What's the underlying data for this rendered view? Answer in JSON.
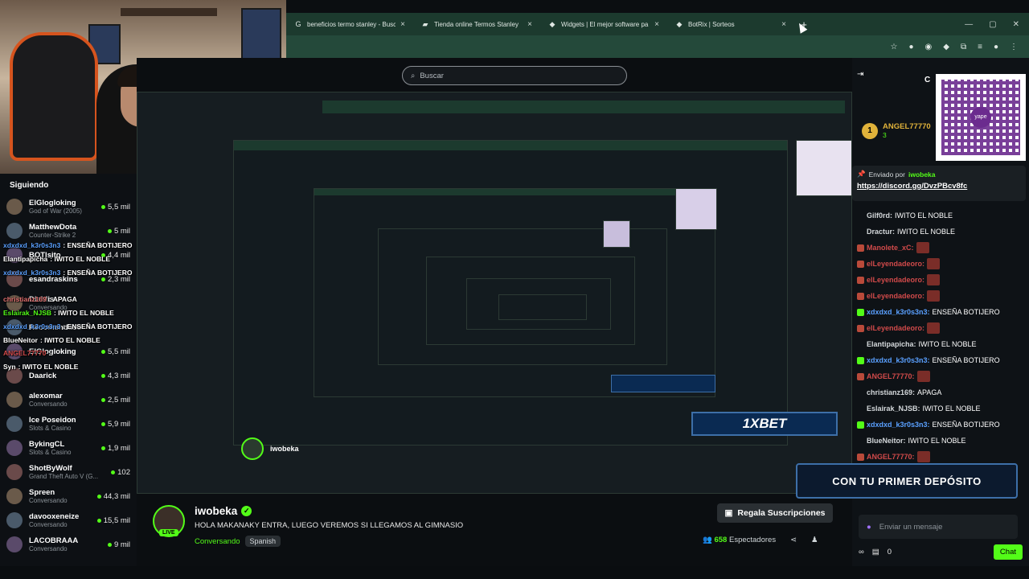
{
  "browser": {
    "tabs": [
      {
        "label": "beneficios termo stanley - Busc",
        "icon": "google-icon"
      },
      {
        "label": "Tienda online Termos Stanley",
        "icon": "store-icon"
      },
      {
        "label": "Widgets | El mejor software pa",
        "icon": "widget-icon"
      },
      {
        "label": "BotRix | Sorteos",
        "icon": "botrix-icon"
      }
    ]
  },
  "search": {
    "placeholder": "Buscar"
  },
  "sidebar": {
    "title": "Siguiendo",
    "items": [
      {
        "name": "ElGlogloking",
        "game": "God of War (2005)",
        "viewers": "5,5 mil"
      },
      {
        "name": "MatthewDota",
        "game": "Counter-Strike 2",
        "viewers": "5 mil"
      },
      {
        "name": "BOTlsito",
        "game": "",
        "viewers": "4,4 mil"
      },
      {
        "name": "esandraskins",
        "game": "",
        "viewers": "2,3 mil"
      },
      {
        "name": "Diablis",
        "game": "Conversando",
        "viewers": ""
      },
      {
        "name": "Recomendado",
        "game": "",
        "viewers": ""
      },
      {
        "name": "ElGlogloking",
        "game": "",
        "viewers": "5,5 mil"
      },
      {
        "name": "Daarick",
        "game": "",
        "viewers": "4,3 mil"
      },
      {
        "name": "alexomar",
        "game": "Conversando",
        "viewers": "2,5 mil"
      },
      {
        "name": "Ice Poseidon",
        "game": "Slots & Casino",
        "viewers": "5,9 mil"
      },
      {
        "name": "BykingCL",
        "game": "Slots & Casino",
        "viewers": "1,9 mil"
      },
      {
        "name": "ShotByWolf",
        "game": "Grand Theft Auto V (G...",
        "viewers": "102"
      },
      {
        "name": "Spreen",
        "game": "Conversando",
        "viewers": "44,3 mil"
      },
      {
        "name": "davooxeneize",
        "game": "Conversando",
        "viewers": "15,5 mil"
      },
      {
        "name": "LACOBRAAA",
        "game": "Conversando",
        "viewers": "9 mil"
      }
    ]
  },
  "overlay_chat": [
    {
      "user": "xdxdxd_k3r0s3n3",
      "text": ": ENSEÑA BOTIJERO"
    },
    {
      "user": "Elantipapicha",
      "text": ": IWITO EL NOBLE"
    },
    {
      "user": "xdxdxd_k3r0s3n3",
      "text": ": ENSEÑA BOTIJERO"
    },
    {
      "user": "",
      "text": ""
    },
    {
      "user": "christianz169",
      "text": ": APAGA"
    },
    {
      "user": "Eslairak_NJSB",
      "text": ": IWITO EL NOBLE"
    },
    {
      "user": "xdxdxd_k3r0s3n3",
      "text": ": ENSEÑA BOTIJERO"
    },
    {
      "user": "BlueNeitor",
      "text": ": IWITO EL NOBLE"
    },
    {
      "user": "ANGEL77770",
      "text": ":"
    },
    {
      "user": "Syn",
      "text": ": IWITO EL NOBLE"
    }
  ],
  "stream": {
    "streamer": "iwobeka",
    "live_label": "LIVE",
    "title": "HOLA MAKANAKY ENTRA, LUEGO VEREMOS SI LLEGAMOS AL GIMNASIO",
    "category": "Conversando",
    "language": "Spanish",
    "subs_button": "Regala Suscripciones",
    "viewers_count": "658",
    "viewers_label": "Espectadores"
  },
  "chat": {
    "header": "Chat",
    "top_gifter": {
      "rank": "1",
      "name": "ANGEL77770",
      "count": "3"
    },
    "pinned": {
      "by_label": "Enviado por",
      "by_user": "iwobeka",
      "link": "https://discord.gg/DvzPBcv8fc"
    },
    "messages": [
      {
        "user": "Gilf0rd",
        "text": "IWITO EL NOBLE",
        "color": "#d4d8db",
        "emote": false
      },
      {
        "user": "Dractur",
        "text": "IWITO EL NOBLE",
        "color": "#d4d8db",
        "emote": false
      },
      {
        "user": "Manolete_xC",
        "text": "",
        "color": "#d14a4a",
        "emote": true
      },
      {
        "user": "elLeyendadeoro",
        "text": "",
        "color": "#d14a4a",
        "emote": true
      },
      {
        "user": "elLeyendadeoro",
        "text": "",
        "color": "#d14a4a",
        "emote": true
      },
      {
        "user": "elLeyendadeoro",
        "text": "",
        "color": "#d14a4a",
        "emote": true
      },
      {
        "user": "xdxdxd_k3r0s3n3",
        "text": "ENSEÑA BOTIJERO",
        "color": "#5aa0ff",
        "emote": false
      },
      {
        "user": "elLeyendadeoro",
        "text": "",
        "color": "#d14a4a",
        "emote": true
      },
      {
        "user": "Elantipapicha",
        "text": "IWITO EL NOBLE",
        "color": "#d4d8db",
        "emote": false
      },
      {
        "user": "xdxdxd_k3r0s3n3",
        "text": "ENSEÑA BOTIJERO",
        "color": "#5aa0ff",
        "emote": false
      },
      {
        "user": "ANGEL77770",
        "text": "",
        "color": "#d14a4a",
        "emote": true
      },
      {
        "user": "christianz169",
        "text": "APAGA",
        "color": "#d4d8db",
        "emote": false
      },
      {
        "user": "Eslairak_NJSB",
        "text": "IWITO EL NOBLE",
        "color": "#d4d8db",
        "emote": false
      },
      {
        "user": "xdxdxd_k3r0s3n3",
        "text": "ENSEÑA BOTIJERO",
        "color": "#5aa0ff",
        "emote": false
      },
      {
        "user": "BlueNeitor",
        "text": "IWITO EL NOBLE",
        "color": "#d4d8db",
        "emote": false
      },
      {
        "user": "ANGEL77770",
        "text": "",
        "color": "#d14a4a",
        "emote": true
      }
    ],
    "input_placeholder": "Enviar un mensaje",
    "points": "0",
    "send_label": "Chat"
  },
  "ads": {
    "banner": "CON TU PRIMER DEPÓSITO",
    "logo": "1XBET"
  },
  "qr": {
    "center_text": "yape"
  },
  "colors": {
    "accent": "#53fc18",
    "tab_bar": "#1c3a2e"
  }
}
